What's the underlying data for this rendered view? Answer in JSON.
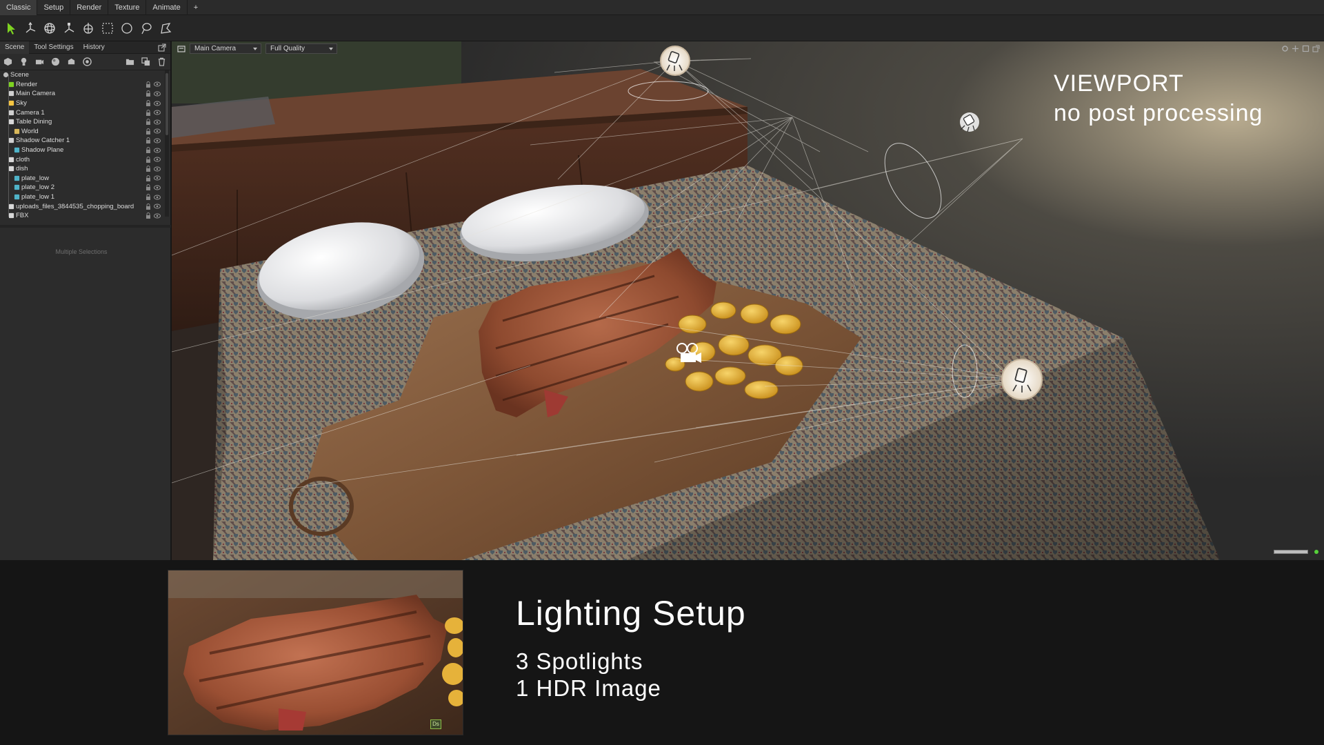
{
  "menu": {
    "tabs": [
      "Classic",
      "Setup",
      "Render",
      "Texture",
      "Animate",
      "+"
    ]
  },
  "toolbar": {
    "tools": [
      "select-arrow-icon",
      "move-gizmo-icon",
      "rotate-gizmo-icon",
      "scale-gizmo-icon",
      "pivot-icon",
      "box-select-icon",
      "circle-select-icon",
      "lasso-select-icon",
      "polygon-select-icon"
    ]
  },
  "panel": {
    "tabs": [
      "Scene",
      "Tool Settings",
      "History"
    ],
    "footer_text": "Multiple Selections"
  },
  "scene_tree": [
    {
      "label": "Scene",
      "icon": "scene-icon",
      "indent": 0
    },
    {
      "label": "Render",
      "icon": "render-icon",
      "indent": 1
    },
    {
      "label": "Main Camera",
      "icon": "camera-icon",
      "indent": 1
    },
    {
      "label": "Sky",
      "icon": "sky-icon",
      "indent": 1
    },
    {
      "label": "Camera 1",
      "icon": "camera-icon",
      "indent": 1
    },
    {
      "label": "Table Dining",
      "icon": "mesh-icon",
      "indent": 1
    },
    {
      "label": "World",
      "icon": "folder-icon",
      "indent": 2
    },
    {
      "label": "Shadow Catcher 1",
      "icon": "shadow-catcher-icon",
      "indent": 1
    },
    {
      "label": "Shadow Plane",
      "icon": "cube-icon",
      "indent": 2
    },
    {
      "label": "cloth",
      "icon": "mesh-icon",
      "indent": 1
    },
    {
      "label": "dish",
      "icon": "mesh-icon",
      "indent": 1
    },
    {
      "label": "plate_low",
      "icon": "cube-icon",
      "indent": 2
    },
    {
      "label": "plate_low 2",
      "icon": "cube-icon",
      "indent": 2
    },
    {
      "label": "plate_low 1",
      "icon": "cube-icon",
      "indent": 2
    },
    {
      "label": "uploads_files_3844535_chopping_board",
      "icon": "mesh-icon",
      "indent": 1
    },
    {
      "label": "FBX",
      "icon": "mesh-icon",
      "indent": 1
    }
  ],
  "viewport": {
    "camera_select": "Main Camera",
    "quality_select": "Full Quality",
    "title_line1": "VIEWPORT",
    "title_line2": "no post processing"
  },
  "caption": {
    "heading": "Lighting Setup",
    "line1": "3 Spotlights",
    "line2": "1 HDR Image",
    "thumb_badge": "Ds"
  },
  "colors": {
    "accent_green": "#56d13a",
    "select_arrow": "#7ed321",
    "ui_dark": "#262626"
  }
}
